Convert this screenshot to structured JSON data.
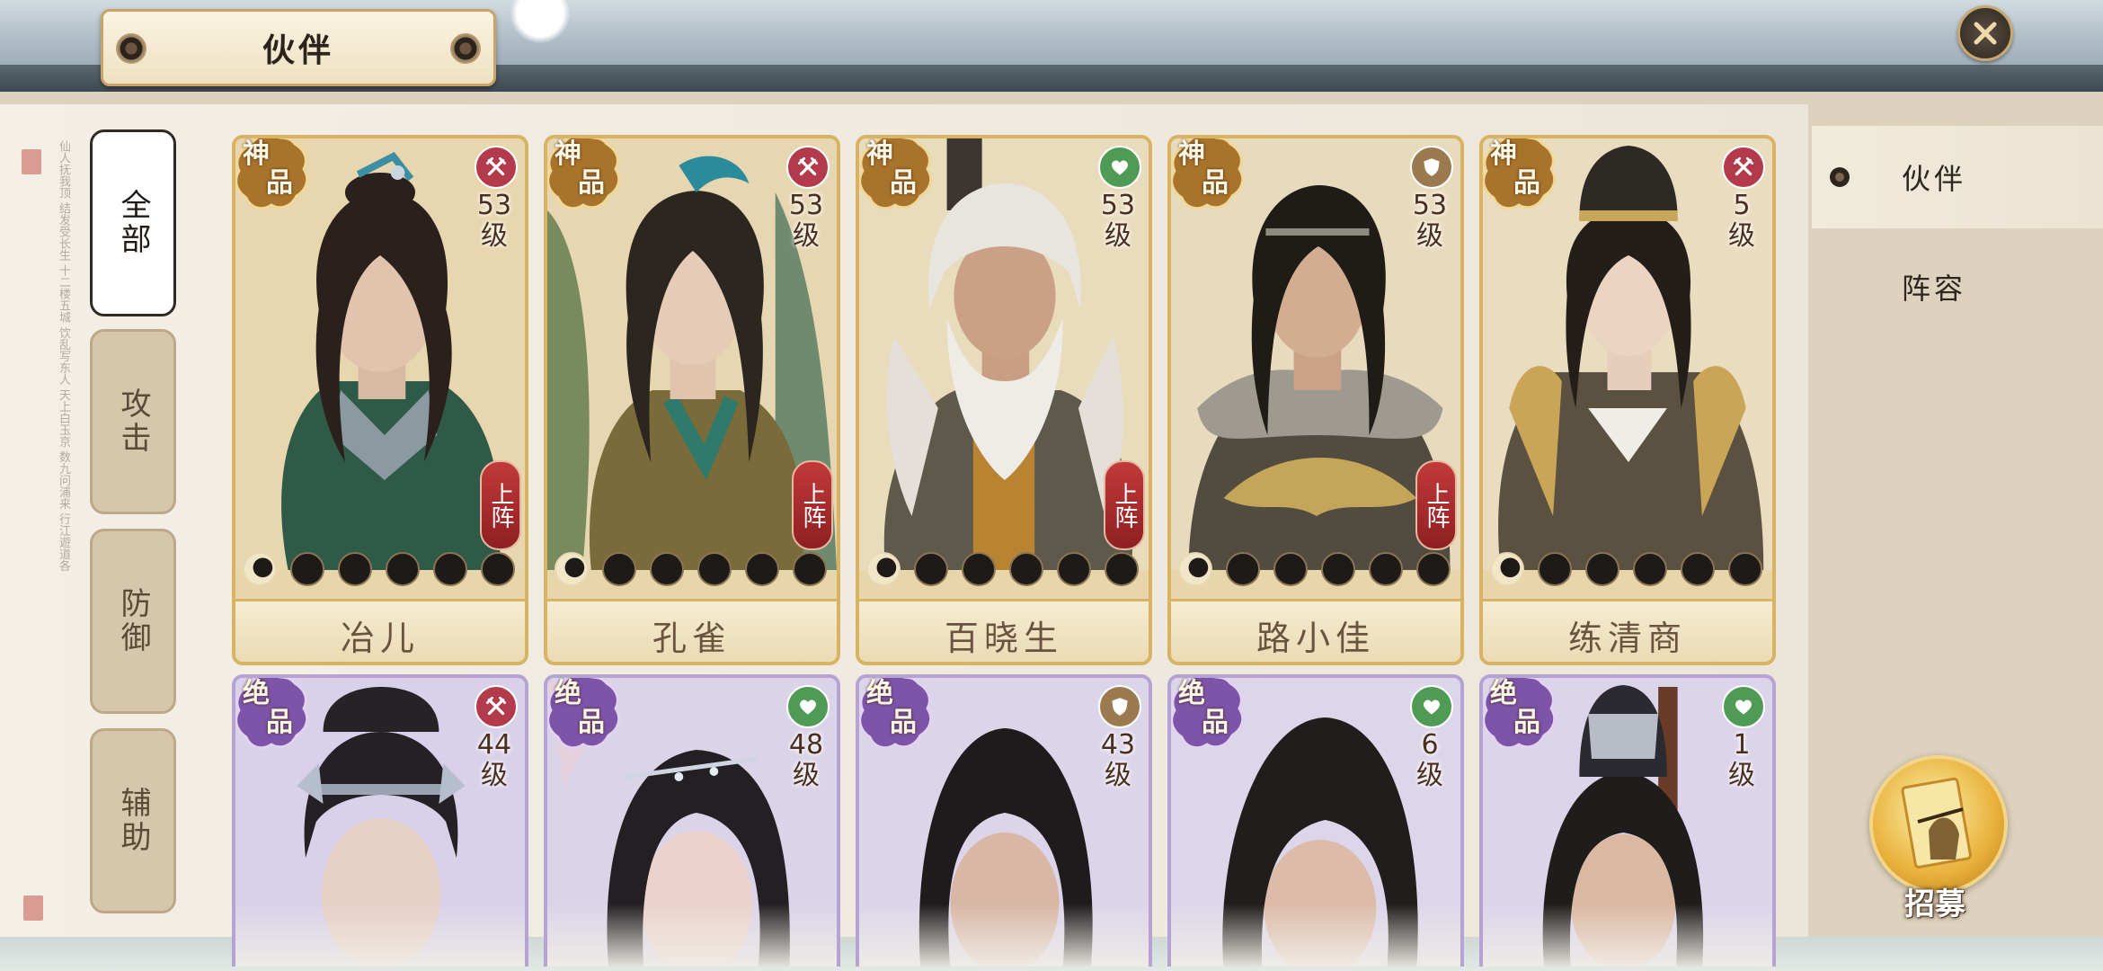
{
  "header": {
    "title": "伙伴",
    "close_icon": "close-x-icon"
  },
  "filters": [
    {
      "label": "全部",
      "active": true
    },
    {
      "label": "攻击",
      "active": false
    },
    {
      "label": "防御",
      "active": false
    },
    {
      "label": "辅助",
      "active": false
    }
  ],
  "sidebar": {
    "tabs": [
      {
        "label": "伙伴",
        "active": true
      },
      {
        "label": "阵容",
        "active": false
      }
    ],
    "recruit_label": "招募"
  },
  "cards": [
    {
      "grade": "神品",
      "role": "attack-icon",
      "level": "53",
      "unit": "级",
      "deploy": "上阵",
      "stars_lit": 1,
      "stars_total": 6,
      "name": "冶儿"
    },
    {
      "grade": "神品",
      "role": "attack-icon",
      "level": "53",
      "unit": "级",
      "deploy": "上阵",
      "stars_lit": 1,
      "stars_total": 6,
      "name": "孔雀"
    },
    {
      "grade": "神品",
      "role": "heal-icon",
      "level": "53",
      "unit": "级",
      "deploy": "上阵",
      "stars_lit": 1,
      "stars_total": 6,
      "name": "百晓生"
    },
    {
      "grade": "神品",
      "role": "defense-icon",
      "level": "53",
      "unit": "级",
      "deploy": "上阵",
      "stars_lit": 1,
      "stars_total": 6,
      "name": "路小佳"
    },
    {
      "grade": "神品",
      "role": "attack-icon",
      "level": "5",
      "unit": "级",
      "deploy": "",
      "stars_lit": 1,
      "stars_total": 6,
      "name": "练清商"
    },
    {
      "grade": "绝品",
      "role": "attack-icon",
      "level": "44",
      "unit": "级"
    },
    {
      "grade": "绝品",
      "role": "heal-icon",
      "level": "48",
      "unit": "级"
    },
    {
      "grade": "绝品",
      "role": "defense-icon",
      "level": "43",
      "unit": "级"
    },
    {
      "grade": "绝品",
      "role": "heal-icon",
      "level": "6",
      "unit": "级"
    },
    {
      "grade": "绝品",
      "role": "heal-icon",
      "level": "1",
      "unit": "级"
    }
  ],
  "colors": {
    "gold_grade": "#a8742c",
    "purple_grade": "#7d54a8",
    "attack_role": "#b23a4a",
    "heal_role": "#4f9a55",
    "defense_role": "#9a7a4e",
    "deploy": "#a82a2e"
  }
}
